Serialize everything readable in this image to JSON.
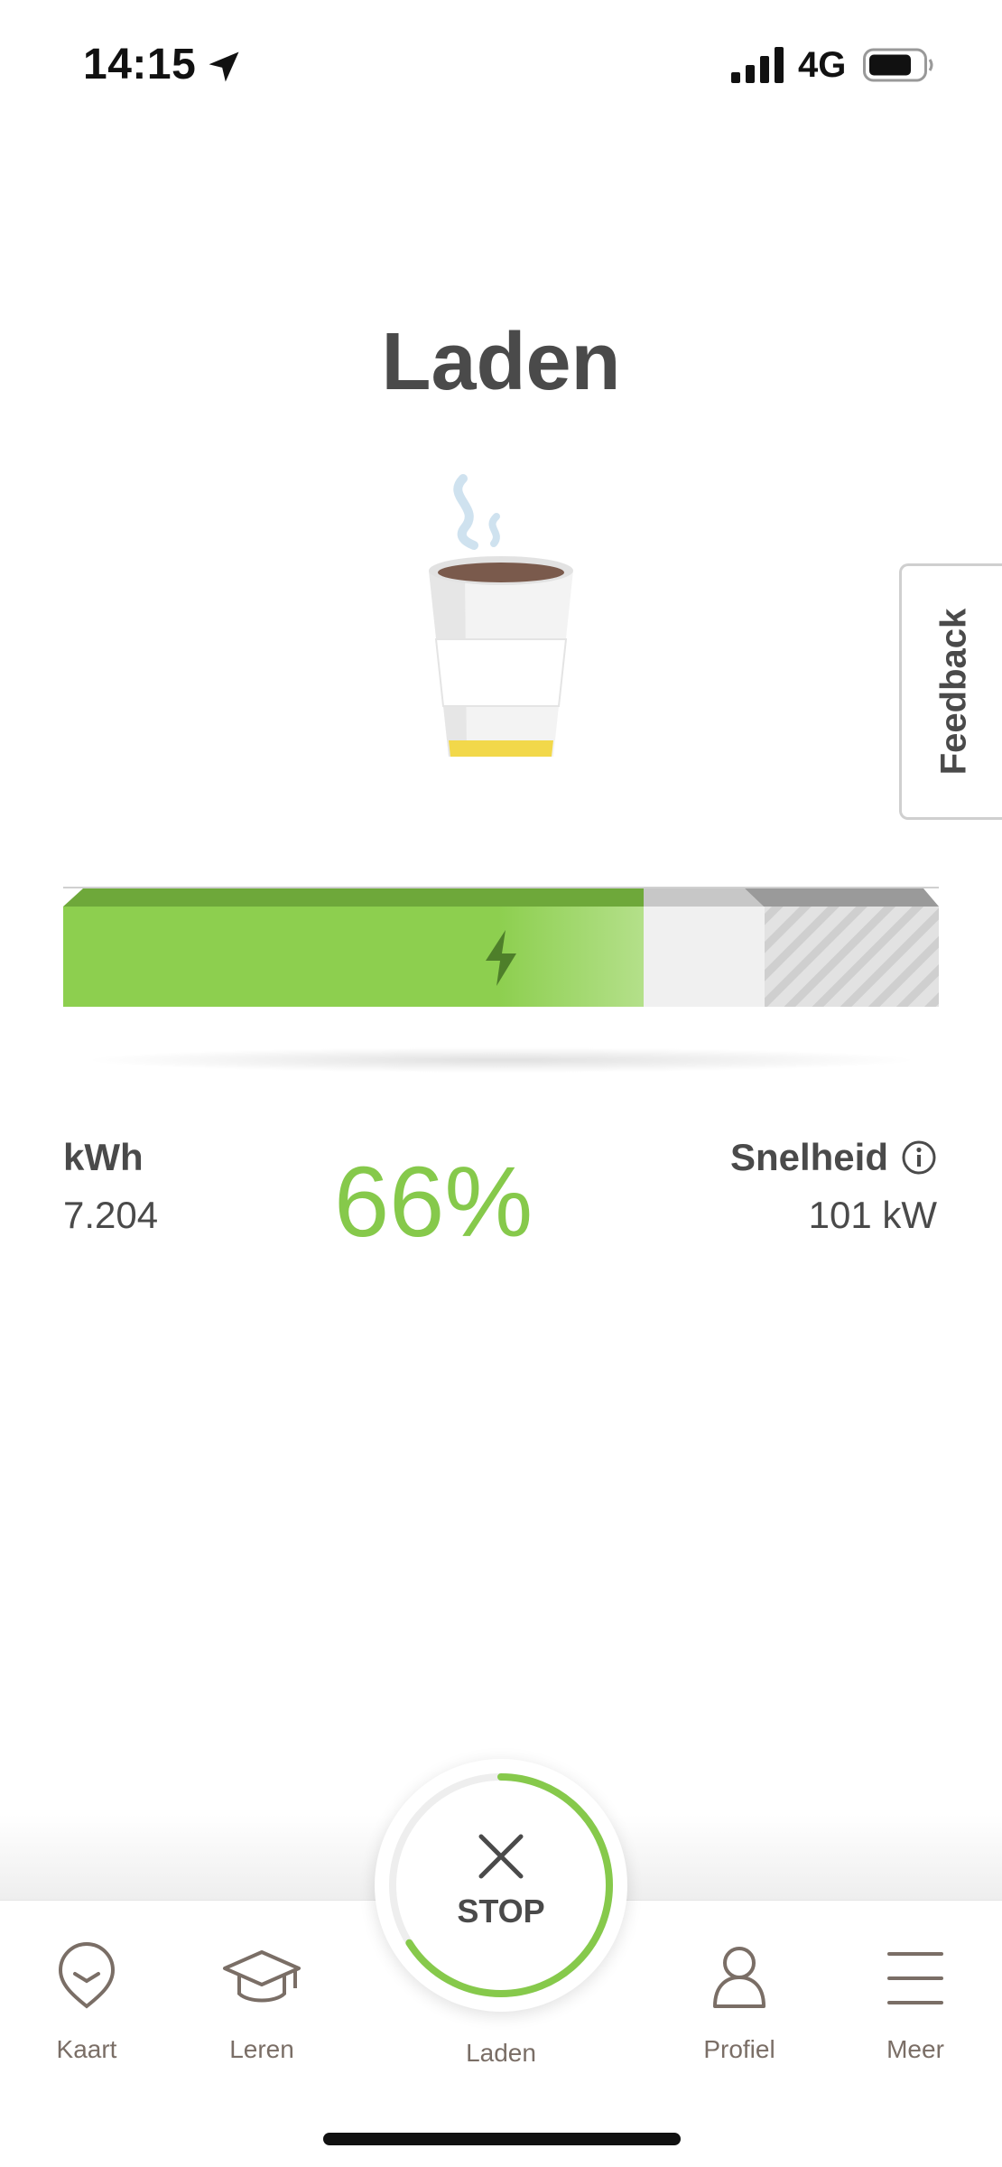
{
  "status_bar": {
    "time": "14:15",
    "network": "4G",
    "icons": [
      "location-arrow-icon",
      "signal-bars-icon",
      "battery-icon"
    ]
  },
  "page": {
    "title": "Laden"
  },
  "feedback": {
    "label": "Feedback"
  },
  "charge": {
    "percent_text": "66%",
    "percent_value": 66,
    "icon": "lightning-bolt-icon",
    "colors": {
      "charged": "#8dcf4f",
      "charged_top": "#6ea83a",
      "remaining": "#f0f0f0",
      "limit": "#d5d5d5"
    }
  },
  "stats": {
    "energy_label": "kWh",
    "energy_value": "7.204",
    "speed_label": "Snelheid",
    "speed_value": "101 kW",
    "speed_info_icon": "info-icon"
  },
  "stop_button": {
    "label": "STOP",
    "icon": "close-x-icon"
  },
  "nav": {
    "items": [
      {
        "label": "Kaart",
        "icon": "map-pin-icon"
      },
      {
        "label": "Leren",
        "icon": "graduation-cap-icon"
      },
      {
        "label": "Laden",
        "icon": "stop-charging-button"
      },
      {
        "label": "Profiel",
        "icon": "person-icon"
      },
      {
        "label": "Meer",
        "icon": "hamburger-menu-icon"
      }
    ]
  },
  "colors": {
    "accent_green": "#86c94b",
    "text_dark": "#4a4a4a",
    "nav_text": "#7a6e66"
  }
}
